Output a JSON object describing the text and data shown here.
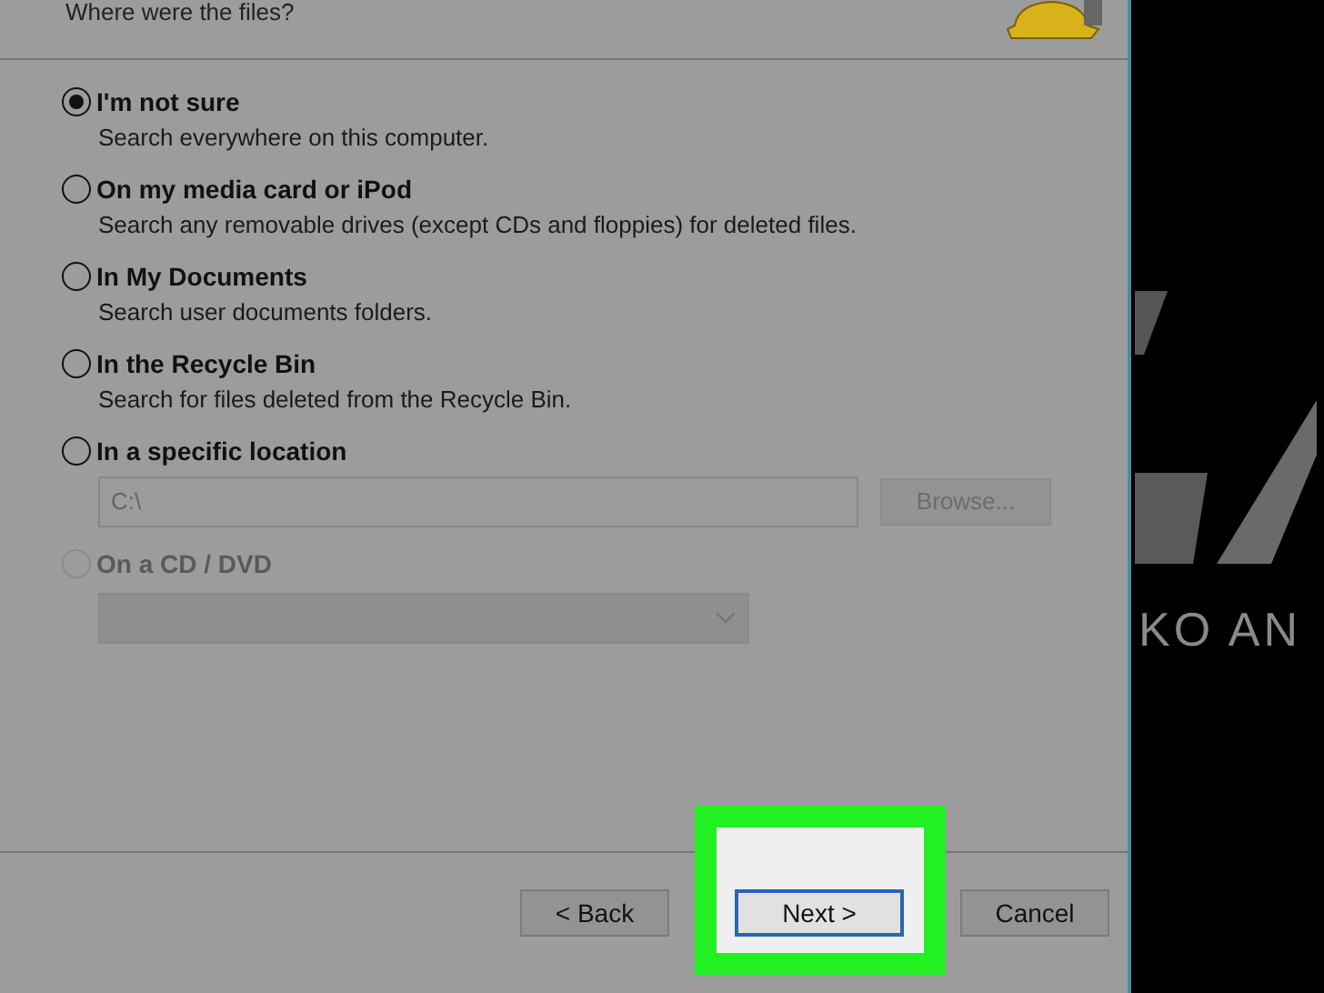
{
  "dialog": {
    "heading": "Where were the files?",
    "options": [
      {
        "label": "I'm not sure",
        "description": "Search everywhere on this computer.",
        "selected": true,
        "disabled": false
      },
      {
        "label": "On my media card or iPod",
        "description": "Search any removable drives (except CDs and floppies) for deleted files.",
        "selected": false,
        "disabled": false
      },
      {
        "label": "In My Documents",
        "description": "Search user documents folders.",
        "selected": false,
        "disabled": false
      },
      {
        "label": "In the Recycle Bin",
        "description": "Search for files deleted from the Recycle Bin.",
        "selected": false,
        "disabled": false
      },
      {
        "label": "In a specific location",
        "selected": false,
        "disabled": false,
        "field": {
          "value": "C:\\",
          "disabled": true
        },
        "button": {
          "label": "Browse...",
          "disabled": true
        }
      },
      {
        "label": "On a CD / DVD",
        "selected": false,
        "disabled": true,
        "dropdown": {
          "disabled": true
        }
      }
    ],
    "buttons": [
      {
        "label": "< Back",
        "focused": false,
        "highlighted": false
      },
      {
        "label": "Next >",
        "focused": true,
        "highlighted": true
      },
      {
        "label": "Cancel",
        "focused": false,
        "highlighted": false
      }
    ]
  },
  "wallpaper": {
    "text": "KO AN"
  }
}
